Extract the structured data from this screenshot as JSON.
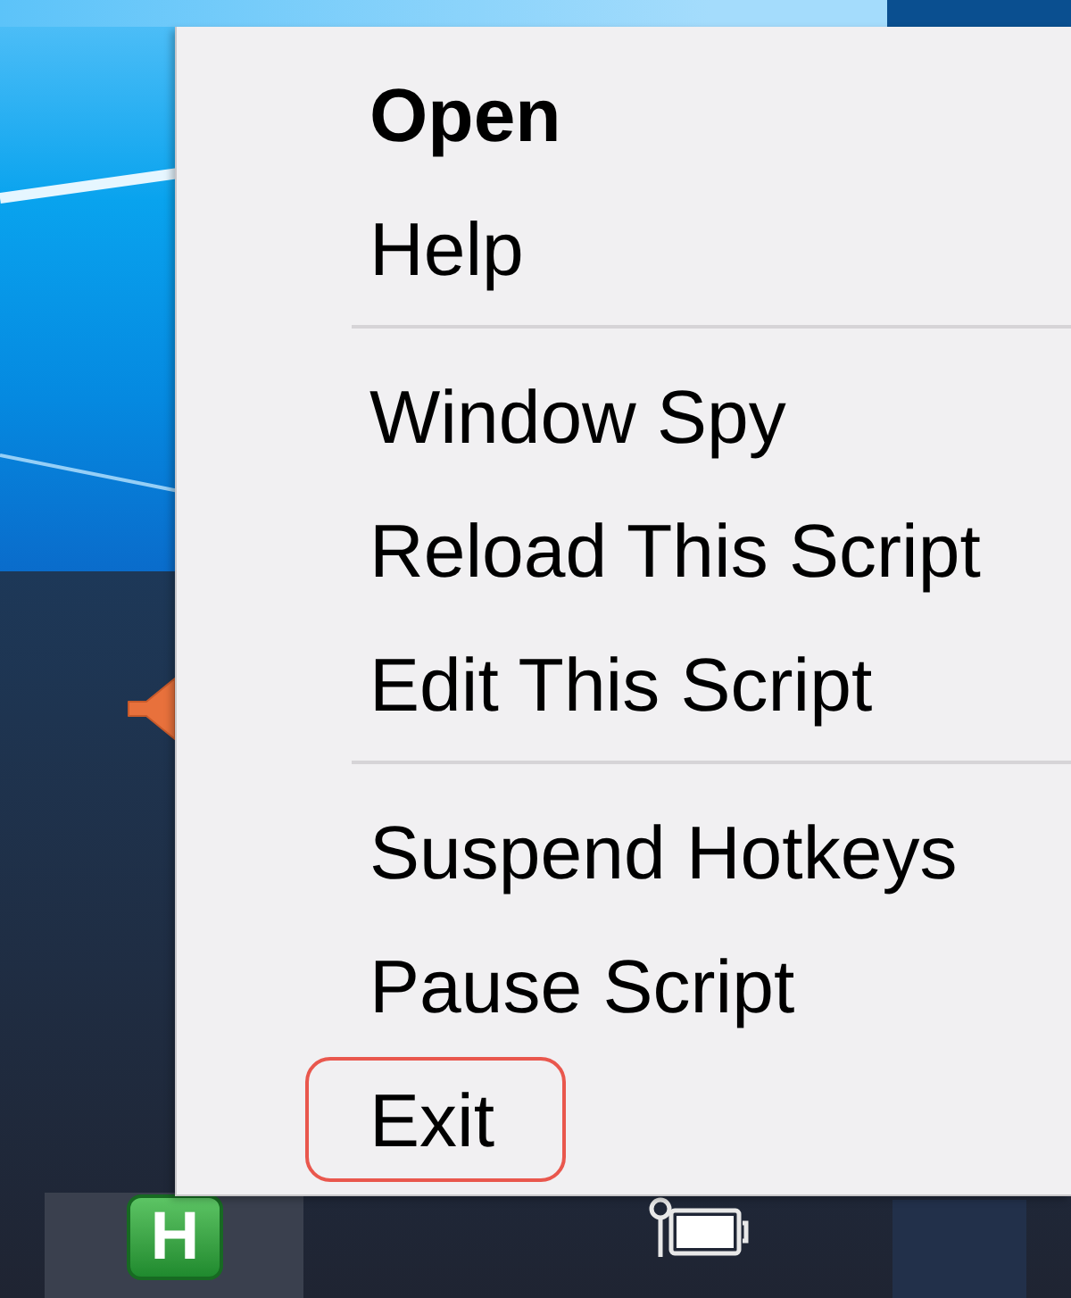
{
  "menu": {
    "items": [
      {
        "kind": "item",
        "label": "Open",
        "default": true,
        "highlighted": false
      },
      {
        "kind": "item",
        "label": "Help",
        "default": false,
        "highlighted": false
      },
      {
        "kind": "separator"
      },
      {
        "kind": "item",
        "label": "Window Spy",
        "default": false,
        "highlighted": false
      },
      {
        "kind": "item",
        "label": "Reload This Script",
        "default": false,
        "highlighted": false
      },
      {
        "kind": "item",
        "label": "Edit This Script",
        "default": false,
        "highlighted": false
      },
      {
        "kind": "separator"
      },
      {
        "kind": "item",
        "label": "Suspend Hotkeys",
        "default": false,
        "highlighted": false
      },
      {
        "kind": "item",
        "label": "Pause Script",
        "default": false,
        "highlighted": false
      },
      {
        "kind": "item",
        "label": "Exit",
        "default": false,
        "highlighted": true
      }
    ]
  },
  "tray": {
    "app_icon": {
      "letter": "H",
      "hovered": true
    }
  }
}
